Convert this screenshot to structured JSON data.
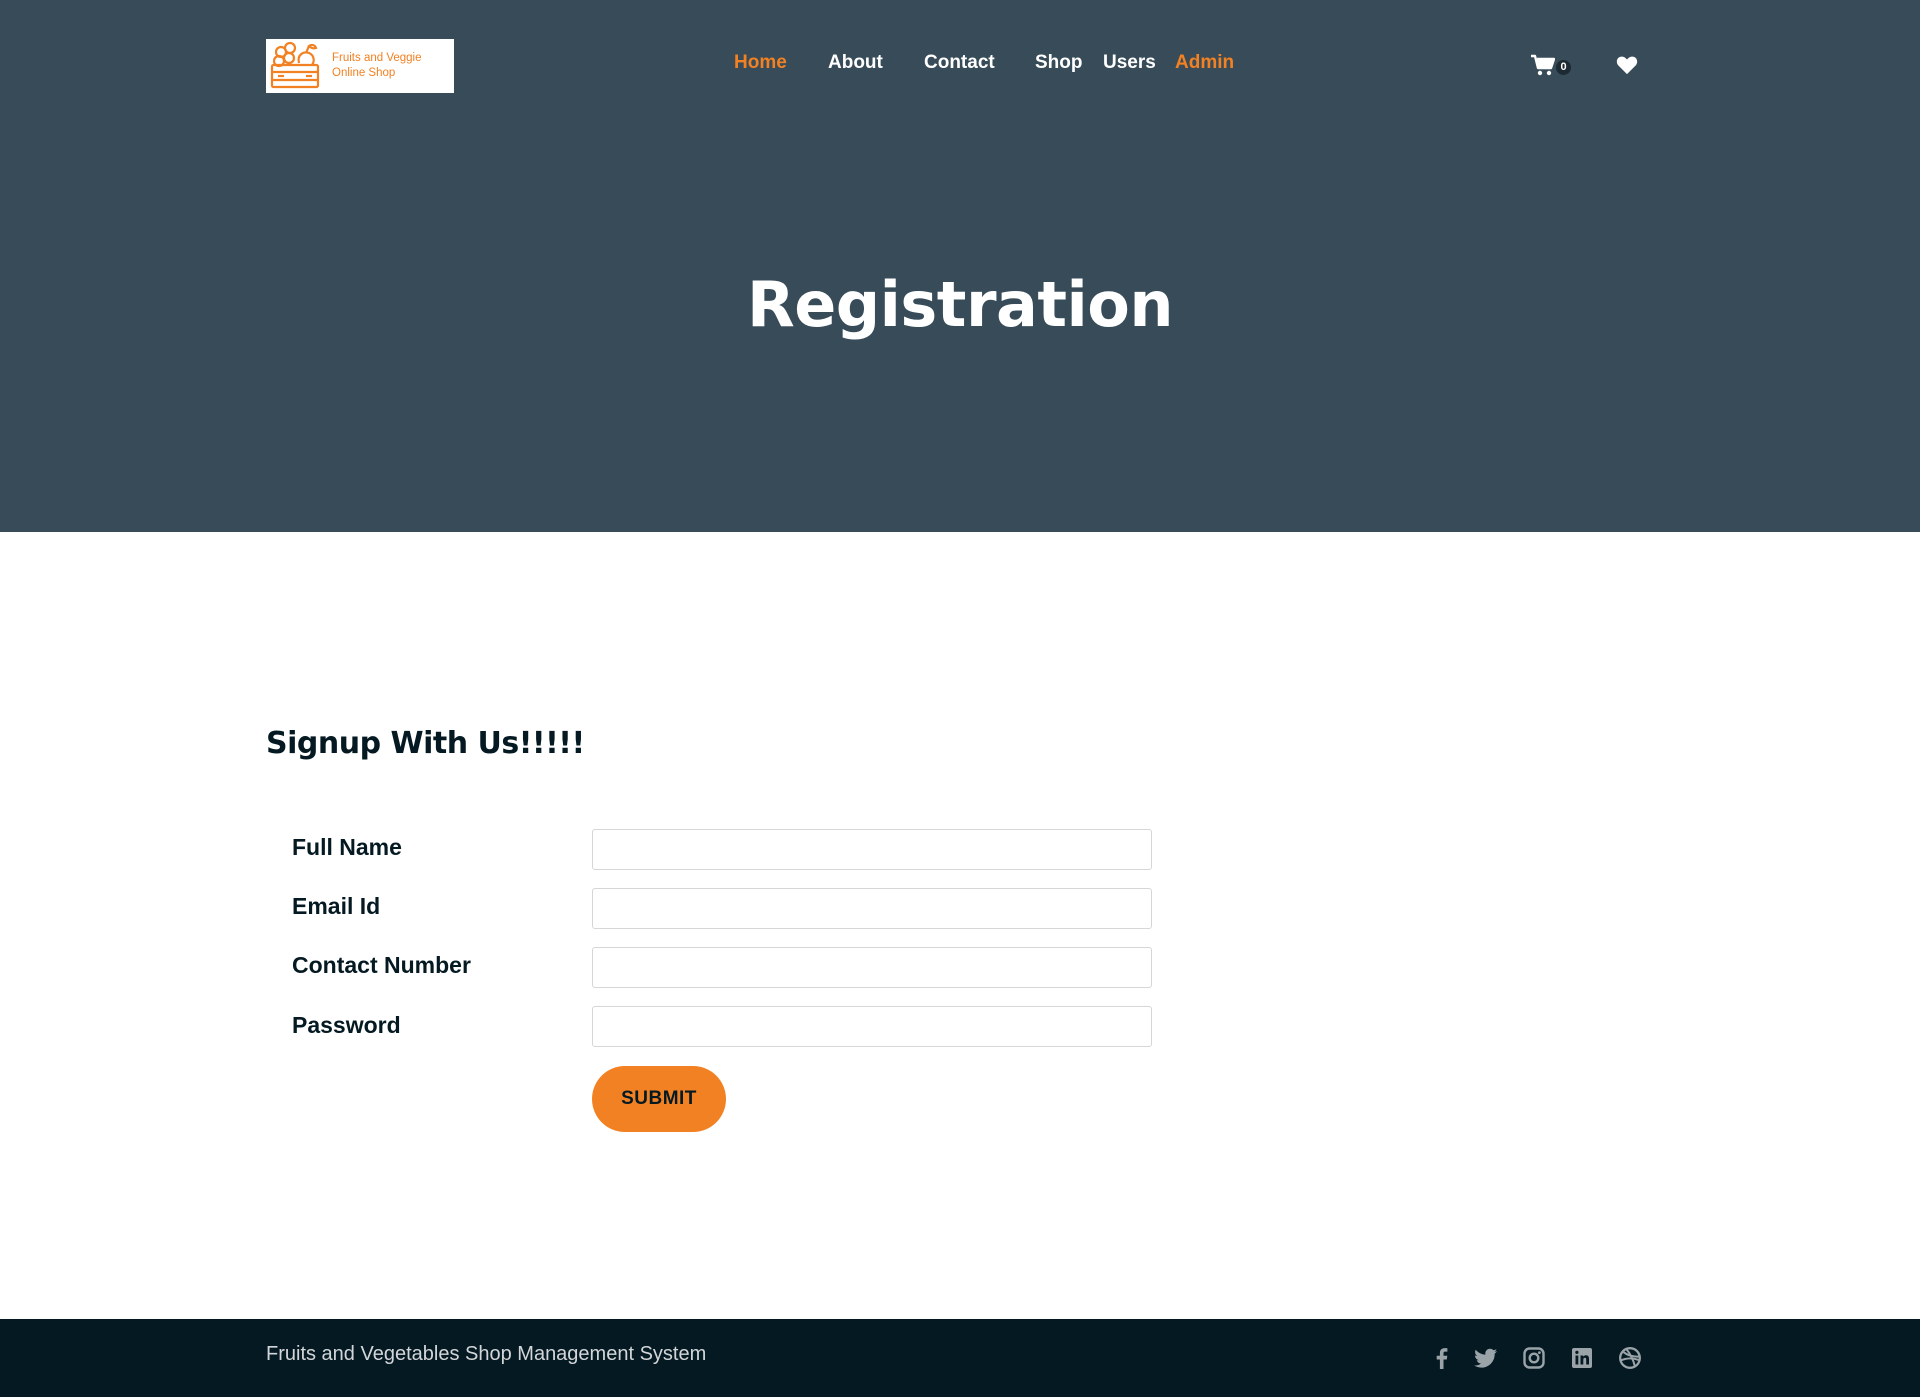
{
  "brand": {
    "logo_line1": "Fruits and Veggie",
    "logo_line2": "Online Shop",
    "accent_color": "#f28123"
  },
  "nav": {
    "items": [
      {
        "label": "Home",
        "active": true
      },
      {
        "label": "About",
        "active": false
      },
      {
        "label": "Contact",
        "active": false
      },
      {
        "label": "Shop",
        "active": false
      },
      {
        "label": "Users",
        "active": false
      },
      {
        "label": "Admin",
        "active": true
      }
    ],
    "cart_count": "0",
    "icons": [
      "shopping-cart-icon",
      "heart-icon"
    ]
  },
  "hero": {
    "title": "Registration",
    "background_color": "#374b58"
  },
  "form": {
    "heading": "Signup With Us!!!!!",
    "fields": [
      {
        "label": "Full Name",
        "value": ""
      },
      {
        "label": "Email Id",
        "value": ""
      },
      {
        "label": "Contact Number",
        "value": ""
      },
      {
        "label": "Password",
        "value": ""
      }
    ],
    "submit_label": "SUBMIT"
  },
  "footer": {
    "text": "Fruits and Vegetables Shop Management System",
    "background_color": "#051922",
    "social_icons": [
      "facebook-icon",
      "twitter-icon",
      "instagram-icon",
      "linkedin-icon",
      "dribbble-icon"
    ]
  }
}
